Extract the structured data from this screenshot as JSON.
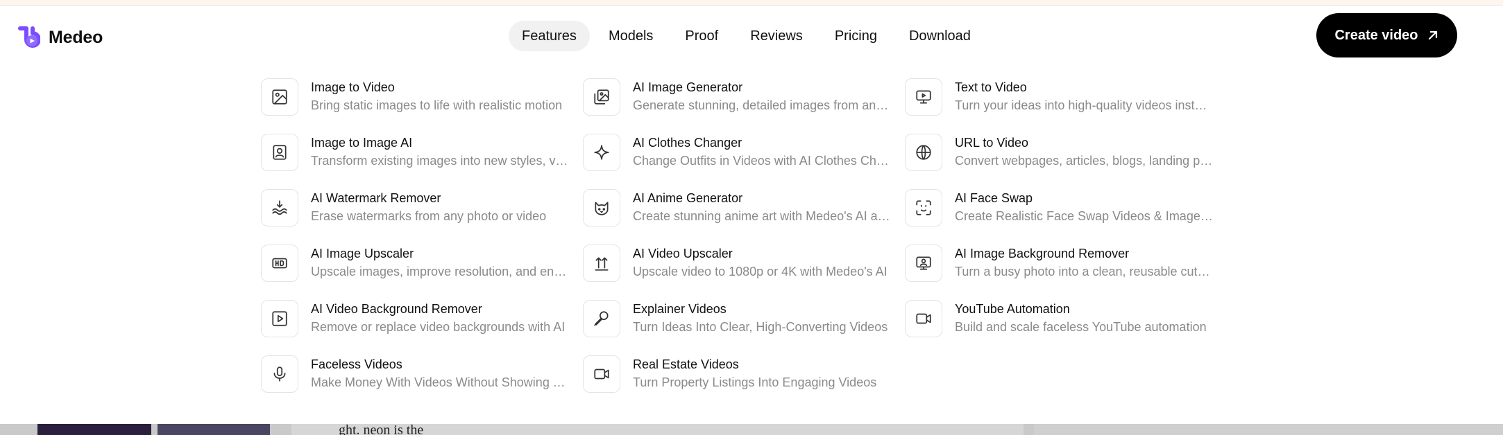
{
  "brand": {
    "name": "Medeo",
    "accent": "#7c4dff"
  },
  "nav": {
    "items": [
      {
        "label": "Features",
        "active": true
      },
      {
        "label": "Models"
      },
      {
        "label": "Proof"
      },
      {
        "label": "Reviews"
      },
      {
        "label": "Pricing"
      },
      {
        "label": "Download"
      }
    ]
  },
  "cta": {
    "label": "Create video",
    "icon": "arrow-up-right-icon"
  },
  "menu": {
    "items": [
      {
        "title": "Image to Video",
        "desc": "Bring static images to life with realistic motion",
        "icon": "image-icon"
      },
      {
        "title": "AI Image Generator",
        "desc": "Generate stunning, detailed images from any text",
        "icon": "images-icon"
      },
      {
        "title": "Text to Video",
        "desc": "Turn your ideas into high-quality videos instantly",
        "icon": "monitor-play-icon"
      },
      {
        "title": "Image to Image AI",
        "desc": "Transform existing images into new styles, vibes",
        "icon": "portrait-icon"
      },
      {
        "title": "AI Clothes Changer",
        "desc": "Change Outfits in Videos with AI Clothes Changer",
        "icon": "sparkle-icon"
      },
      {
        "title": "URL to Video",
        "desc": "Convert webpages, articles, blogs, landing pages",
        "icon": "globe-icon"
      },
      {
        "title": "AI Watermark Remover",
        "desc": "Erase watermarks from any photo or video",
        "icon": "watermark-icon"
      },
      {
        "title": "AI Anime Generator",
        "desc": "Create stunning anime art with Medeo's AI anime",
        "icon": "cat-icon"
      },
      {
        "title": "AI Face Swap",
        "desc": "Create Realistic Face Swap Videos & Images free",
        "icon": "face-scan-icon"
      },
      {
        "title": "AI Image Upscaler",
        "desc": "Upscale images, improve resolution, and enhance",
        "icon": "hd-icon"
      },
      {
        "title": "AI Video Upscaler",
        "desc": "Upscale video to 1080p or 4K with Medeo's AI",
        "icon": "upscale-arrows-icon"
      },
      {
        "title": "AI Image Background Remover",
        "desc": "Turn a busy photo into a clean, reusable cutout",
        "icon": "image-bg-icon"
      },
      {
        "title": "AI Video Background Remover",
        "desc": "Remove or replace video backgrounds with AI",
        "icon": "play-square-icon"
      },
      {
        "title": "Explainer Videos",
        "desc": "Turn Ideas Into Clear, High-Converting Videos",
        "icon": "microphone-icon"
      },
      {
        "title": "YouTube Automation",
        "desc": "Build and scale faceless YouTube automation",
        "icon": "video-camera-icon"
      },
      {
        "title": "Faceless Videos",
        "desc": "Make Money With Videos Without Showing Your Face",
        "icon": "mic-icon"
      },
      {
        "title": "Real Estate Videos",
        "desc": "Turn Property Listings Into Engaging Videos",
        "icon": "video-camera-icon"
      }
    ]
  },
  "background": {
    "fragment": "ght.           neon is the"
  }
}
